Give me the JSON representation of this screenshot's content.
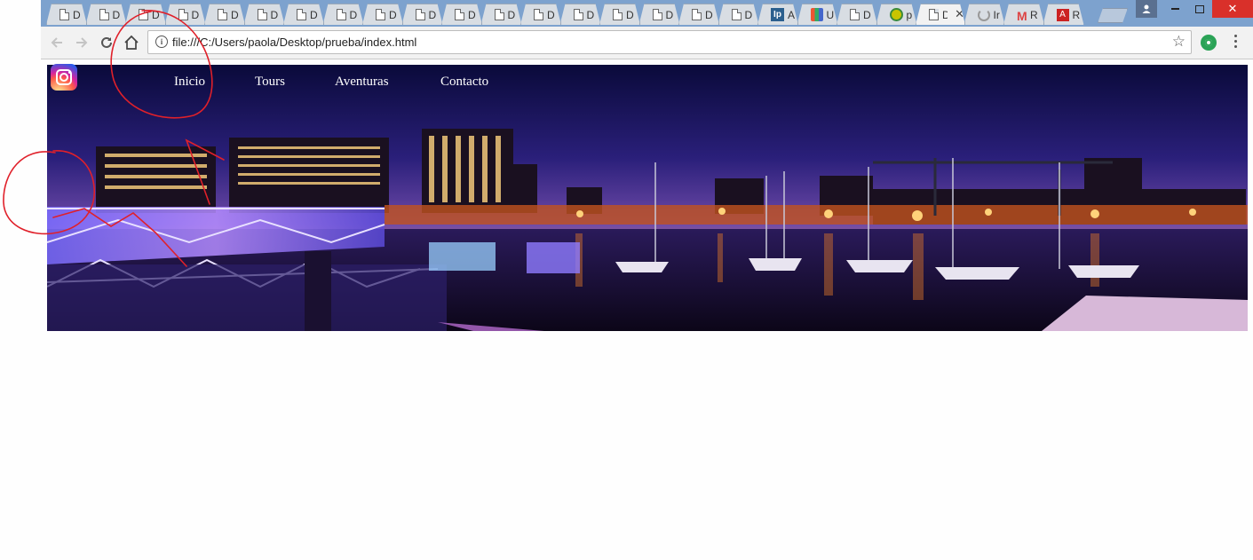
{
  "browser": {
    "tabs": [
      {
        "title": "D",
        "favicon": "document-icon"
      },
      {
        "title": "D",
        "favicon": "document-icon"
      },
      {
        "title": "D",
        "favicon": "document-icon"
      },
      {
        "title": "D",
        "favicon": "document-icon"
      },
      {
        "title": "D",
        "favicon": "document-icon"
      },
      {
        "title": "D",
        "favicon": "document-icon"
      },
      {
        "title": "D",
        "favicon": "document-icon"
      },
      {
        "title": "D",
        "favicon": "document-icon"
      },
      {
        "title": "D",
        "favicon": "document-icon"
      },
      {
        "title": "D",
        "favicon": "document-icon"
      },
      {
        "title": "D",
        "favicon": "document-icon"
      },
      {
        "title": "D",
        "favicon": "document-icon"
      },
      {
        "title": "D",
        "favicon": "document-icon"
      },
      {
        "title": "D",
        "favicon": "document-icon"
      },
      {
        "title": "D",
        "favicon": "document-icon"
      },
      {
        "title": "D",
        "favicon": "document-icon"
      },
      {
        "title": "D",
        "favicon": "document-icon"
      },
      {
        "title": "D",
        "favicon": "document-icon"
      },
      {
        "title": "A",
        "favicon": "ip-icon"
      },
      {
        "title": "U",
        "favicon": "u-logo-icon"
      },
      {
        "title": "D",
        "favicon": "document-icon"
      },
      {
        "title": "p",
        "favicon": "green-circle-icon"
      },
      {
        "title": "D",
        "favicon": "document-icon",
        "active": true
      },
      {
        "title": "Ir",
        "favicon": "loading-icon"
      },
      {
        "title": "R",
        "favicon": "gmail-icon"
      },
      {
        "title": "R",
        "favicon": "acrobat-icon"
      }
    ],
    "url": "file:///C:/Users/paola/Desktop/prueba/index.html",
    "colors": {
      "tabstrip": "#7da2ce",
      "close_button": "#d9302a"
    }
  },
  "page": {
    "nav": [
      {
        "label": "Inicio"
      },
      {
        "label": "Tours"
      },
      {
        "label": "Aventuras"
      },
      {
        "label": "Contacto"
      }
    ],
    "social_icon": "instagram-icon",
    "banner": "harbor-night-cityscape"
  },
  "annotations": {
    "color": "#e0202a"
  }
}
